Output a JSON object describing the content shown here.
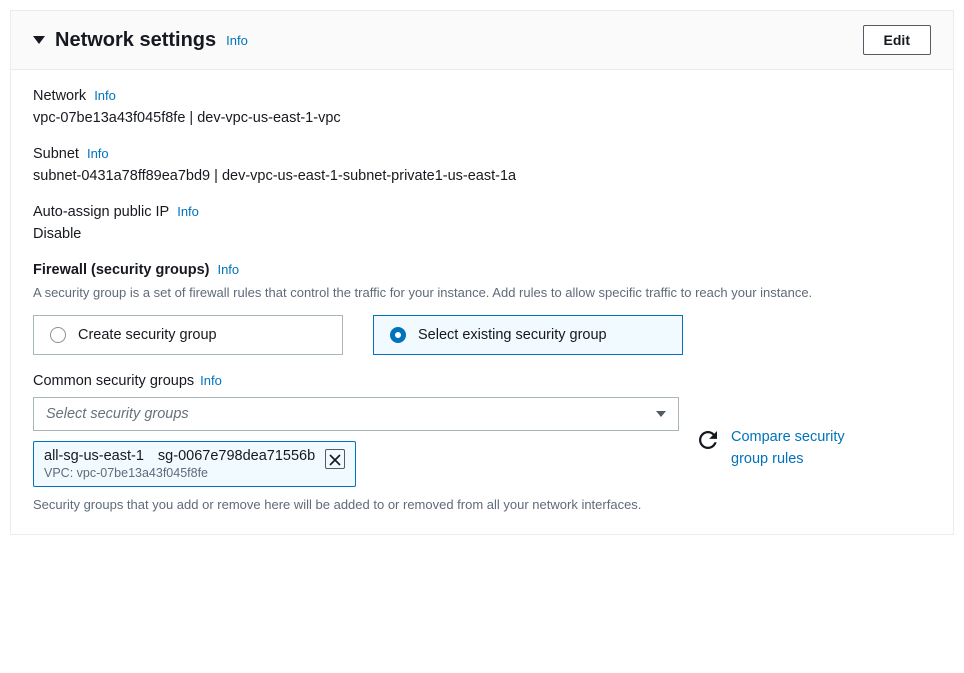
{
  "header": {
    "title": "Network settings",
    "info": "Info",
    "edit": "Edit"
  },
  "network": {
    "label": "Network",
    "info": "Info",
    "value": "vpc-07be13a43f045f8fe | dev-vpc-us-east-1-vpc"
  },
  "subnet": {
    "label": "Subnet",
    "info": "Info",
    "value": "subnet-0431a78ff89ea7bd9 | dev-vpc-us-east-1-subnet-private1-us-east-1a"
  },
  "publicIp": {
    "label": "Auto-assign public IP",
    "info": "Info",
    "value": "Disable"
  },
  "firewall": {
    "label": "Firewall (security groups)",
    "info": "Info",
    "desc": "A security group is a set of firewall rules that control the traffic for your instance. Add rules to allow specific traffic to reach your instance.",
    "option_create": "Create security group",
    "option_select": "Select existing security group"
  },
  "commonSg": {
    "label": "Common security groups",
    "info": "Info",
    "placeholder": "Select security groups",
    "compare": "Compare security group rules",
    "chip_name": "all-sg-us-east-1",
    "chip_id": "sg-0067e798dea71556b",
    "chip_vpc": "VPC: vpc-07be13a43f045f8fe",
    "helper": "Security groups that you add or remove here will be added to or removed from all your network interfaces."
  }
}
